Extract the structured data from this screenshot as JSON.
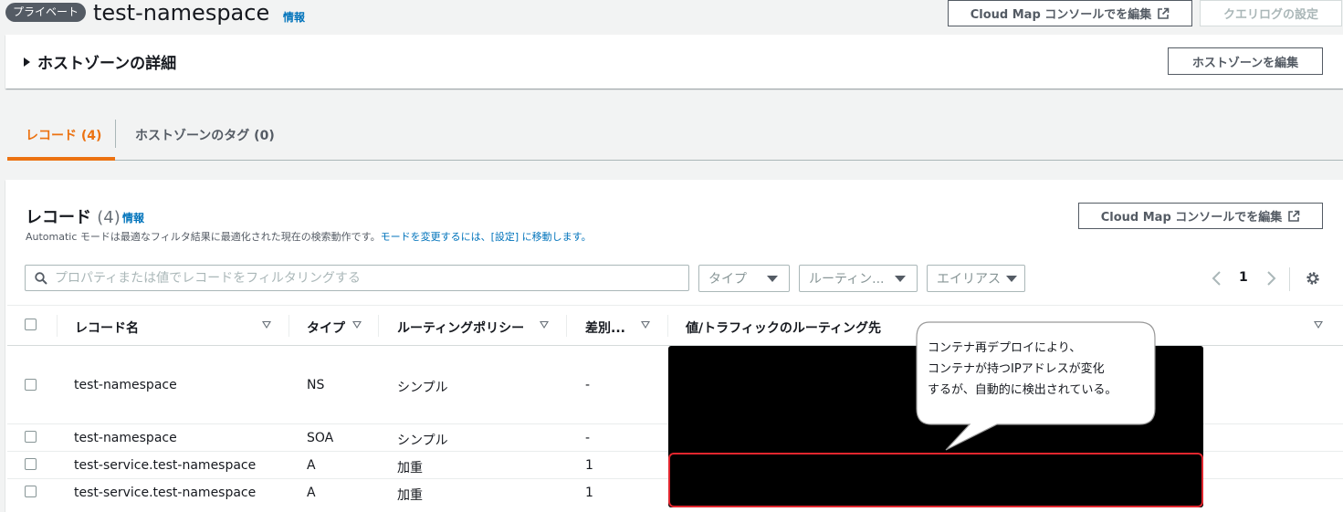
{
  "header": {
    "badge": "プライベート",
    "title": "test-namespace",
    "info": "情報",
    "cloudmap_button": "Cloud Map コンソールでを編集",
    "query_log_button": "クエリログの設定"
  },
  "details": {
    "title": "ホストゾーンの詳細",
    "edit_button": "ホストゾーンを編集"
  },
  "tabs": [
    {
      "label": "レコード (4)",
      "active": true
    },
    {
      "label": "ホストゾーンのタグ (0)",
      "active": false
    }
  ],
  "records": {
    "heading": "レコード",
    "count": "(4)",
    "info": "情報",
    "desc_text": "Automatic モードは最適なフィルタ結果に最適化された現在の検索動作です。",
    "desc_link": "モードを変更するには、[設定] に移動します。",
    "cloudmap_button": "Cloud Map コンソールでを編集",
    "search_placeholder": "プロパティまたは値でレコードをフィルタリングする",
    "filter_type": "タイプ",
    "filter_routing": "ルーティン...",
    "filter_alias": "エイリアス",
    "page": "1",
    "columns": [
      "レコード名",
      "タイプ",
      "ルーティングポリシー",
      "差別...",
      "値/トラフィックのルーティング先"
    ],
    "rows": [
      {
        "name": "test-namespace",
        "type": "NS",
        "policy": "シンプル",
        "diff": "-"
      },
      {
        "name": "test-namespace",
        "type": "SOA",
        "policy": "シンプル",
        "diff": "-"
      },
      {
        "name": "test-service.test-namespace",
        "type": "A",
        "policy": "加重",
        "diff": "1"
      },
      {
        "name": "test-service.test-namespace",
        "type": "A",
        "policy": "加重",
        "diff": "1"
      }
    ]
  },
  "callout": {
    "line1": "コンテナ再デプロイにより、",
    "line2": "コンテナが持つIPアドレスが変化",
    "line3": "するが、自動的に検出されている。"
  },
  "colors": {
    "accent": "#ec7211",
    "link": "#0073bb",
    "highlight": "#e0262e"
  }
}
